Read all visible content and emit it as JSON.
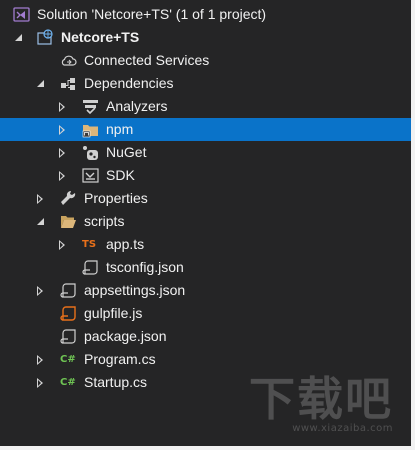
{
  "solution": {
    "label": "Solution 'Netcore+TS' (1 of 1 project)",
    "icon": "visual-studio-solution-icon"
  },
  "project": {
    "label": "Netcore+TS",
    "icon": "web-project-icon"
  },
  "items": {
    "connected_services": "Connected Services",
    "dependencies": "Dependencies",
    "analyzers": "Analyzers",
    "npm": "npm",
    "nuget": "NuGet",
    "sdk": "SDK",
    "properties": "Properties",
    "scripts": "scripts",
    "app_ts": "app.ts",
    "tsconfig_json": "tsconfig.json",
    "appsettings_json": "appsettings.json",
    "gulpfile_js": "gulpfile.js",
    "package_json": "package.json",
    "program_cs": "Program.cs",
    "startup_cs": "Startup.cs"
  },
  "badges": {
    "ts": "TS",
    "cs": "C#"
  },
  "selected_item": "npm",
  "colors": {
    "background": "#252526",
    "selection": "#0a73c9",
    "text": "#f1f1f1",
    "folder": "#dcb67a",
    "typescript": "#e8701a",
    "csharp": "#6fc454"
  },
  "watermark": {
    "brand": "下载吧",
    "url": "www.xiazaiba.com"
  }
}
